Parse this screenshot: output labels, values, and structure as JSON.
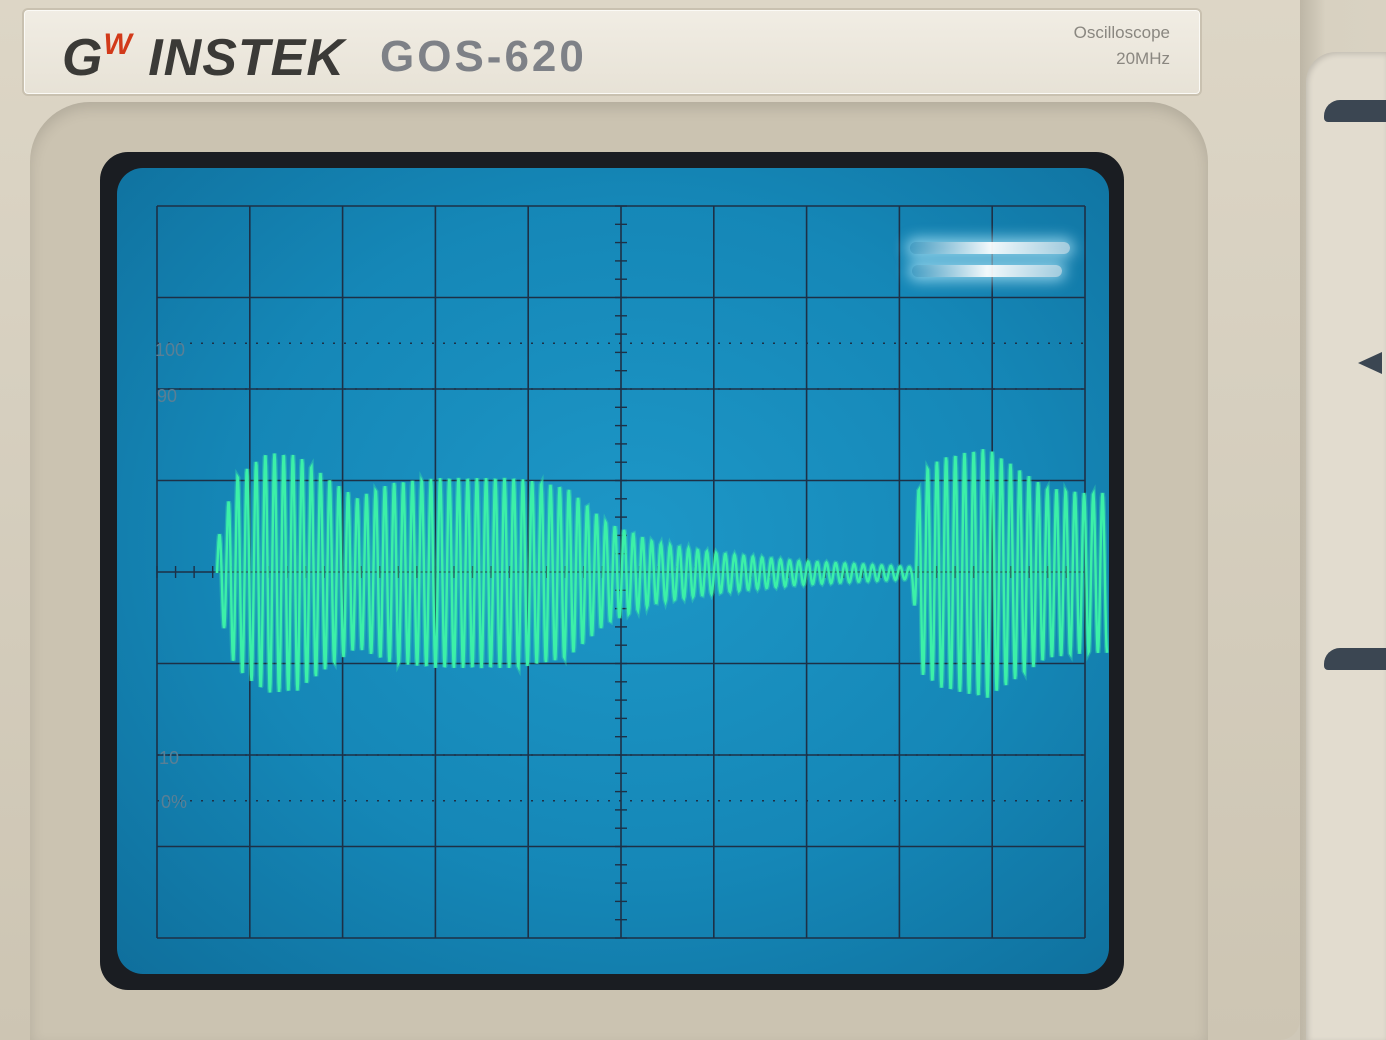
{
  "nameplate": {
    "brand": "INSTEK",
    "brand_prefix": "G",
    "brand_w": "W",
    "model": "GOS-620",
    "kind_line1": "Oscilloscope",
    "kind_line2": "20MHz"
  },
  "screen": {
    "graticule_labels": {
      "l100": "100",
      "l90": "90",
      "l10": "10",
      "l0": "0%"
    },
    "trace_color": "#3cf0a8",
    "grid_color": "#1d3046",
    "background_color": "#1587b7"
  },
  "icons": {
    "side_arrow": "left-triangle-icon"
  }
}
